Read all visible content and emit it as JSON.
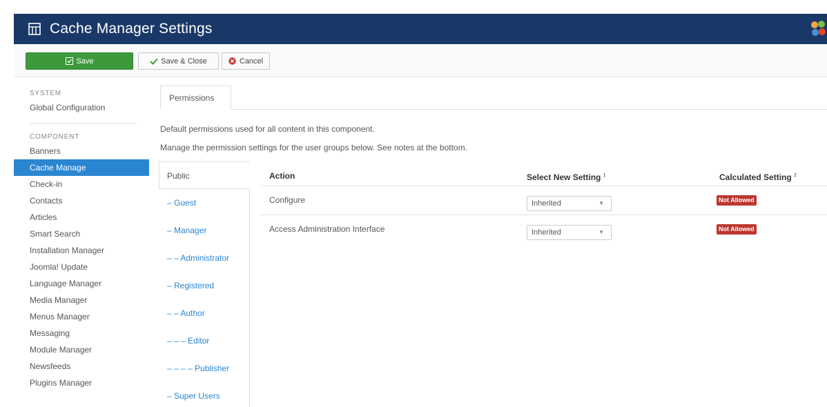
{
  "header": {
    "title": "Cache Manager Settings",
    "bg_color": "#1a3867",
    "icons": {
      "component": "grid-icon",
      "logo": "joomla-logo-icon"
    }
  },
  "toolbar": {
    "save_label": "Save",
    "save_close_label": "Save & Close",
    "cancel_label": "Cancel",
    "save_color": "#3c9a3c",
    "cancel_icon_color": "#c0392b"
  },
  "sidebar": {
    "system_heading": "SYSTEM",
    "system_items": [
      "Global Configuration"
    ],
    "component_heading": "COMPONENT",
    "component_items": [
      "Banners",
      "Cache Manage",
      "Check-in",
      "Contacts",
      "Articles",
      "Smart Search",
      "Installation Manager",
      "Joomla! Update",
      "Language Manager",
      "Media Manager",
      "Menus Manager",
      "Messaging",
      "Module Manager",
      "Newsfeeds",
      "Plugins Manager"
    ],
    "active_item": "Cache Manage",
    "active_color": "#2b86d1"
  },
  "tab": {
    "label": "Permissions"
  },
  "description": {
    "line1": "Default permissions used for all content in this component.",
    "line2": "Manage the permission settings for the user groups below. See notes at the bottom."
  },
  "groups": [
    "Public",
    "– Guest",
    "– Manager",
    "– – Administrator",
    "– Registered",
    "– – Author",
    "– – – Editor",
    "– – – – Publisher",
    "– Super Users"
  ],
  "permissions": {
    "headers": {
      "action": "Action",
      "select": "Select New Setting",
      "calculated": "Calculated Setting",
      "note1": "1",
      "note2": "2"
    },
    "rows": [
      {
        "action": "Configure",
        "setting": "Inherited",
        "calculated": "Not Allowed"
      },
      {
        "action": "Access Administration Interface",
        "setting": "Inherited",
        "calculated": "Not Allowed"
      }
    ],
    "badge_color": "#bd362f"
  }
}
